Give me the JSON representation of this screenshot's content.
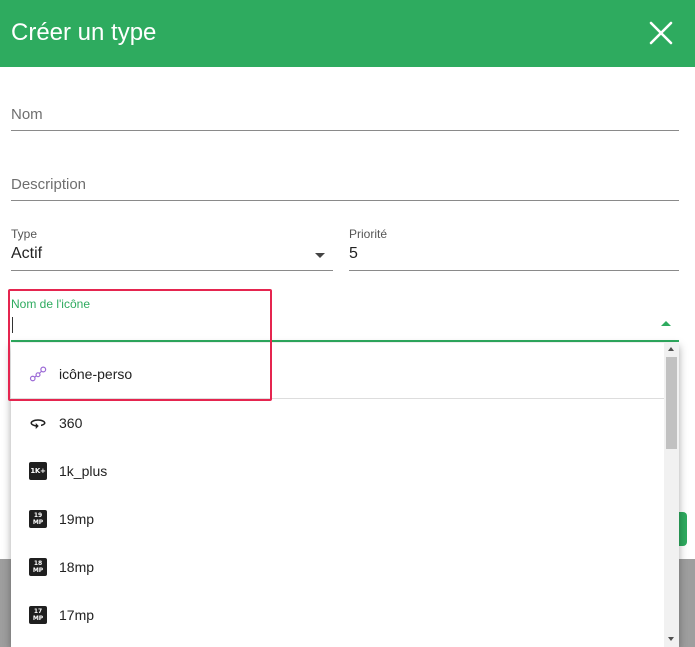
{
  "dialog": {
    "title": "Créer un type",
    "close_icon": "close-icon"
  },
  "form": {
    "name_label": "Nom",
    "description_label": "Description",
    "type": {
      "label": "Type",
      "value": "Actif"
    },
    "priority": {
      "label": "Priorité",
      "value": "5"
    },
    "icon_name": {
      "label": "Nom de l'icône",
      "value": ""
    }
  },
  "dropdown": {
    "items": [
      {
        "label": "icône-perso",
        "icon": "custom-graph-icon"
      },
      {
        "label": "360",
        "icon": "rotate-360-icon"
      },
      {
        "label": "1k_plus",
        "icon": "1k-plus-icon",
        "glyph": "1K+"
      },
      {
        "label": "19mp",
        "icon": "19mp-icon",
        "glyph_top": "19",
        "glyph_bottom": "MP"
      },
      {
        "label": "18mp",
        "icon": "18mp-icon",
        "glyph_top": "18",
        "glyph_bottom": "MP"
      },
      {
        "label": "17mp",
        "icon": "17mp-icon",
        "glyph_top": "17",
        "glyph_bottom": "MP"
      }
    ]
  },
  "colors": {
    "header": "#2eab5f",
    "accent": "#2eab5f",
    "highlight_border": "#e5254f",
    "custom_icon": "#9c6ad6"
  }
}
